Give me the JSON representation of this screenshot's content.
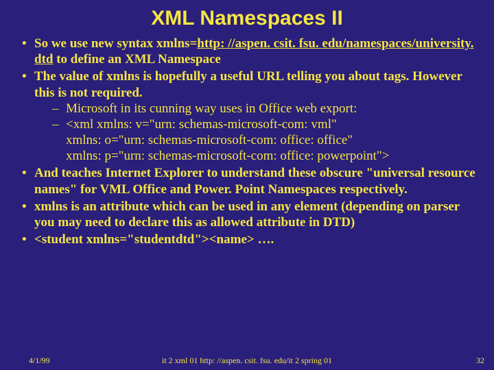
{
  "title": "XML Namespaces II",
  "bullets": {
    "b1_pre": "So we use new syntax ",
    "b1_bold": "xmlns=",
    "b1_link": "http: //aspen. csit. fsu. edu/namespaces/university. dtd",
    "b1_post": " to define an XML Namespace",
    "b2_pre": "The value of ",
    "b2_bold": "xmlns",
    "b2_post": " is hopefully a useful URL telling you about tags. However this is not required.",
    "b2_sub1": "Microsoft in its cunning way uses in Office web export:",
    "b2_sub2_l1": "<xml xmlns: v=\"urn: schemas-microsoft-com: vml\"",
    "b2_sub2_l2": "xmlns: o=\"urn: schemas-microsoft-com: office: office\"",
    "b2_sub2_l3": "xmlns: p=\"urn: schemas-microsoft-com: office: powerpoint\">",
    "b3": "And teaches Internet Explorer to understand these obscure \"universal resource names\" for VML Office and Power. Point Namespaces respectively.",
    "b4_bold": "xmlns",
    "b4_post": " is an attribute which can be used in any element (depending on parser you may need to declare this as allowed attribute in DTD)",
    "b5": "<student xmlns=\"studentdtd\"><name> …."
  },
  "footer": {
    "date": "4/1/99",
    "center": "it 2 xml 01  http: //aspen. csit. fsu. edu/it 2 spring 01",
    "page": "32"
  }
}
